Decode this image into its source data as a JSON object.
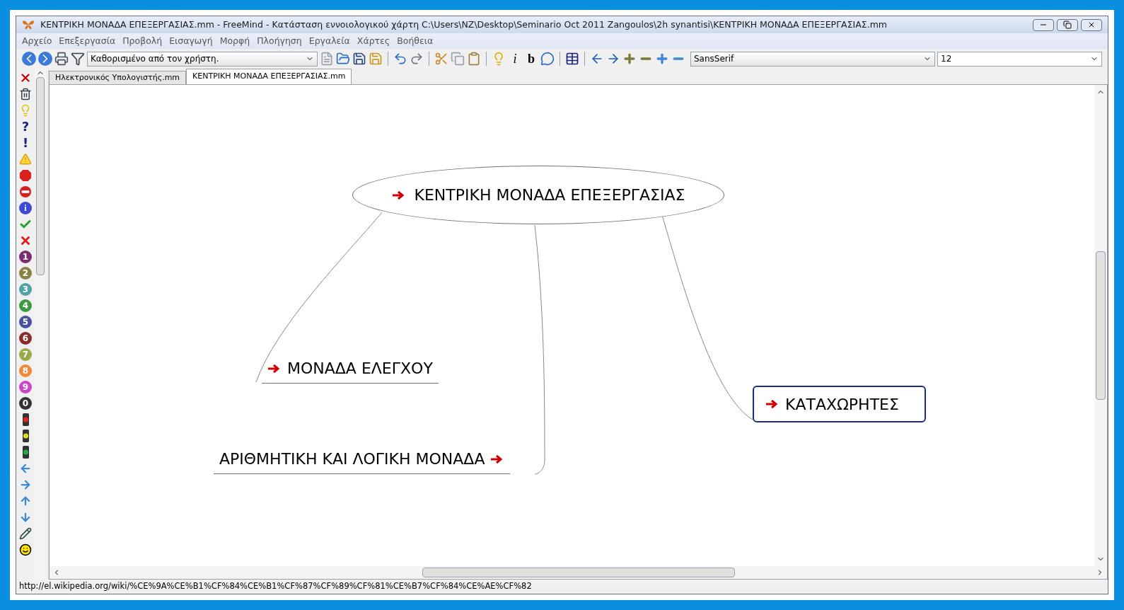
{
  "window": {
    "title": "ΚΕΝΤΡΙΚΗ ΜΟΝΑΔΑ ΕΠΕΞΕΡΓΑΣΙΑΣ.mm - FreeMind - Κατάσταση εννοιολογικού χάρτη C:\\Users\\NZ\\Desktop\\Seminario Oct 2011 Zangoulos\\2h synantisi\\ΚΕΝΤΡΙΚΗ ΜΟΝΑΔΑ ΕΠΕΞΕΡΓΑΣΙΑΣ.mm"
  },
  "menu": [
    "Αρχείο",
    "Επεξεργασία",
    "Προβολή",
    "Εισαγωγή",
    "Μορφή",
    "Πλοήγηση",
    "Εργαλεία",
    "Χάρτες",
    "Βοήθεια"
  ],
  "toolbar": {
    "filter": "Καθορισμένο από τον χρήστη.",
    "font": "SansSerif",
    "size": "12",
    "buttons": [
      {
        "kind": "back"
      },
      {
        "kind": "forward"
      },
      {
        "kind": "print"
      },
      {
        "kind": "filter"
      },
      {
        "kind": "combo"
      },
      {
        "kind": "new"
      },
      {
        "kind": "open"
      },
      {
        "kind": "save"
      },
      {
        "kind": "saveas"
      },
      {
        "kind": "sep"
      },
      {
        "kind": "undo"
      },
      {
        "kind": "redo"
      },
      {
        "kind": "sep"
      },
      {
        "kind": "cut"
      },
      {
        "kind": "copy"
      },
      {
        "kind": "paste"
      },
      {
        "kind": "sep"
      },
      {
        "kind": "bulb"
      },
      {
        "kind": "char",
        "label": "i"
      },
      {
        "kind": "char",
        "label": "b"
      },
      {
        "kind": "comment"
      },
      {
        "kind": "sep"
      },
      {
        "kind": "table"
      },
      {
        "kind": "sep"
      },
      {
        "kind": "left"
      },
      {
        "kind": "right"
      },
      {
        "kind": "plus"
      },
      {
        "kind": "minus"
      },
      {
        "kind": "plus2"
      },
      {
        "kind": "minus2"
      }
    ]
  },
  "tabs": [
    {
      "label": "Ηλεκτρονικός Υπολογιστής.mm",
      "selected": false
    },
    {
      "label": "ΚΕΝΤΡΙΚΗ ΜΟΝΑΔΑ ΕΠΕΞΕΡΓΑΣΙΑΣ.mm",
      "selected": true
    }
  ],
  "icon_bar": [
    {
      "kind": "delete"
    },
    {
      "kind": "trash"
    },
    {
      "kind": "bulb"
    },
    {
      "kind": "glyph",
      "label": "?",
      "color": "#1a237e"
    },
    {
      "kind": "glyph",
      "label": "!",
      "color": "#1a237e"
    },
    {
      "kind": "warning"
    },
    {
      "kind": "stop"
    },
    {
      "kind": "no-entry"
    },
    {
      "kind": "info",
      "label": "i"
    },
    {
      "kind": "check"
    },
    {
      "kind": "cross"
    },
    {
      "kind": "number",
      "label": "1",
      "color": "#7b2d6e"
    },
    {
      "kind": "number",
      "label": "2",
      "color": "#8a8244"
    },
    {
      "kind": "number",
      "label": "3",
      "color": "#4fa3a3"
    },
    {
      "kind": "number",
      "label": "4",
      "color": "#3f9a3f"
    },
    {
      "kind": "number",
      "label": "5",
      "color": "#4b4fa3"
    },
    {
      "kind": "number",
      "label": "6",
      "color": "#8a2a2a"
    },
    {
      "kind": "number",
      "label": "7",
      "color": "#9aaa4a"
    },
    {
      "kind": "number",
      "label": "8",
      "color": "#f08a3a"
    },
    {
      "kind": "number",
      "label": "9",
      "color": "#cc44cc"
    },
    {
      "kind": "number",
      "label": "0",
      "color": "#333333"
    },
    {
      "kind": "light",
      "color": "#dd2222"
    },
    {
      "kind": "light",
      "color": "#dddd22"
    },
    {
      "kind": "light",
      "color": "#22aa44"
    },
    {
      "kind": "arrow-left"
    },
    {
      "kind": "arrow-right"
    },
    {
      "kind": "arrow-up"
    },
    {
      "kind": "arrow-down"
    },
    {
      "kind": "pencil"
    },
    {
      "kind": "smiley"
    }
  ],
  "map": {
    "root": {
      "label": "ΚΕΝΤΡΙΚΗ ΜΟΝΑΔΑ ΕΠΕΞΕΡΓΑΣΙΑΣ"
    },
    "children": [
      {
        "label": "ΜΟΝΑΔΑ ΕΛΕΓΧΟΥ",
        "kind": "fork",
        "arrow_after": false
      },
      {
        "label": "ΑΡΙΘΜΗΤΙΚΗ ΚΑΙ ΛΟΓΙΚΗ ΜΟΝΑΔΑ",
        "kind": "fork",
        "arrow_after": true
      },
      {
        "label": "ΚΑΤΑΧΩΡΗΤΕΣ",
        "kind": "bubble",
        "arrow_after": false
      }
    ]
  },
  "status_bar": "http://el.wikipedia.org/wiki/%CE%9A%CE%B1%CF%84%CE%B1%CF%87%CF%89%CF%81%CE%B7%CF%84%CE%AE%CF%82"
}
